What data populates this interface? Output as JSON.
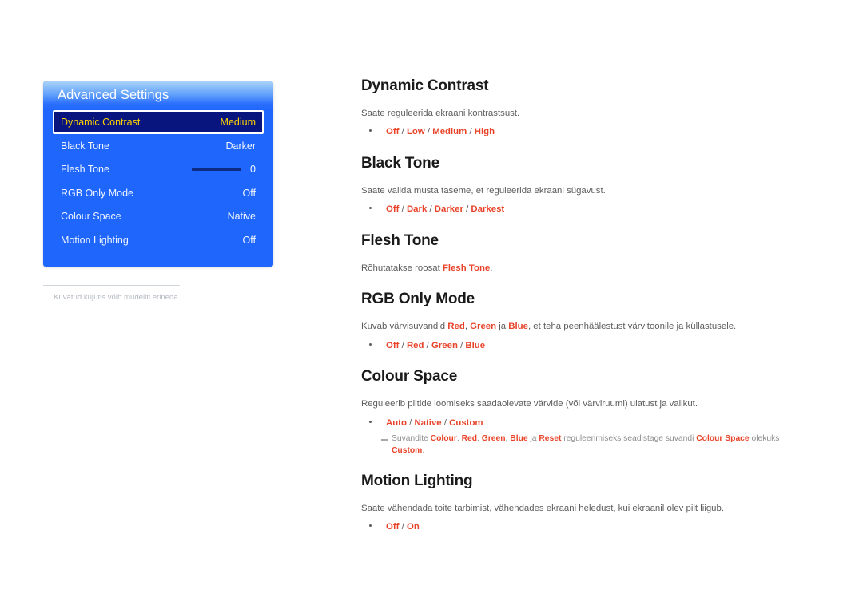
{
  "osd": {
    "title": "Advanced Settings",
    "rows": [
      {
        "label": "Dynamic Contrast",
        "value": "Medium",
        "selected": true,
        "type": "value"
      },
      {
        "label": "Black Tone",
        "value": "Darker",
        "selected": false,
        "type": "value"
      },
      {
        "label": "Flesh Tone",
        "value": "0",
        "selected": false,
        "type": "slider"
      },
      {
        "label": "RGB Only Mode",
        "value": "Off",
        "selected": false,
        "type": "value"
      },
      {
        "label": "Colour Space",
        "value": "Native",
        "selected": false,
        "type": "value"
      },
      {
        "label": "Motion Lighting",
        "value": "Off",
        "selected": false,
        "type": "value"
      }
    ],
    "footnote": "Kuvatud kujutis võib mudeliti erineda.",
    "colors": {
      "panel_blue": "#1f66fd",
      "selected_bg": "#09157e",
      "selected_text": "#ffd200",
      "header_gradient_top": "#a9d2f7"
    }
  },
  "content": {
    "sections": [
      {
        "title": "Dynamic Contrast",
        "desc": "Saate reguleerida ekraani kontrastsust.",
        "options": [
          "Off",
          "Low",
          "Medium",
          "High"
        ],
        "note": null
      },
      {
        "title": "Black Tone",
        "desc": "Saate valida musta taseme, et reguleerida ekraani sügavust.",
        "options": [
          "Off",
          "Dark",
          "Darker",
          "Darkest"
        ],
        "note": null
      },
      {
        "title": "Flesh Tone",
        "desc_pre": "Rõhutatakse roosat ",
        "desc_hl": "Flesh Tone",
        "desc_post": ".",
        "options": [],
        "note": null
      },
      {
        "title": "RGB Only Mode",
        "desc_rich": true,
        "desc_parts": [
          {
            "t": "Kuvab värvisuvandid ",
            "hl": false
          },
          {
            "t": "Red",
            "hl": true
          },
          {
            "t": ", ",
            "hl": false
          },
          {
            "t": "Green",
            "hl": true
          },
          {
            "t": " ja ",
            "hl": false
          },
          {
            "t": "Blue",
            "hl": true
          },
          {
            "t": ", et teha peenhäälestust värvitoonile ja küllastusele.",
            "hl": false
          }
        ],
        "options": [
          "Off",
          "Red",
          "Green",
          "Blue"
        ],
        "note": null
      },
      {
        "title": "Colour Space",
        "desc": "Reguleerib piltide loomiseks saadaolevate värvide (või värviruumi) ulatust ja valikut.",
        "options": [
          "Auto",
          "Native",
          "Custom"
        ],
        "note_parts": [
          {
            "t": "Suvandite ",
            "hl": false
          },
          {
            "t": "Colour",
            "hl": true
          },
          {
            "t": ", ",
            "hl": false
          },
          {
            "t": "Red",
            "hl": true
          },
          {
            "t": ", ",
            "hl": false
          },
          {
            "t": "Green",
            "hl": true
          },
          {
            "t": ", ",
            "hl": false
          },
          {
            "t": "Blue",
            "hl": true
          },
          {
            "t": " ja ",
            "hl": false
          },
          {
            "t": "Reset",
            "hl": true
          },
          {
            "t": " reguleerimiseks seadistage suvandi ",
            "hl": false
          },
          {
            "t": "Colour Space",
            "hl": true
          },
          {
            "t": " olekuks ",
            "hl": false
          },
          {
            "t": "Custom",
            "hl": true
          },
          {
            "t": ".",
            "hl": false
          }
        ]
      },
      {
        "title": "Motion Lighting",
        "desc": "Saate vähendada toite tarbimist, vähendades ekraani heledust, kui ekraanil olev pilt liigub.",
        "options": [
          "Off",
          "On"
        ],
        "note": null
      }
    ],
    "option_separator": " / ",
    "colors": {
      "highlight_red": "#e8442a",
      "body_gray": "#5d5d5d",
      "heading": "#1a1a1a"
    }
  }
}
